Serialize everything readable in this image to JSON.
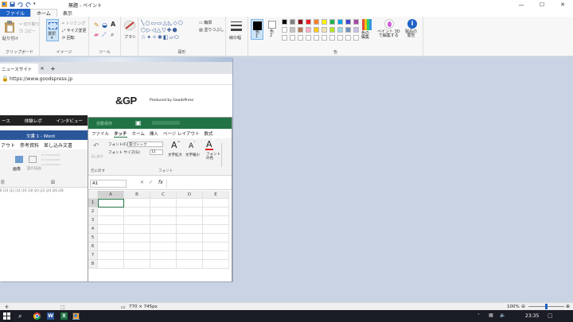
{
  "window": {
    "title": "無題 - ペイント",
    "quick_access": [
      "save-icon",
      "undo-icon",
      "redo-icon",
      "dropdown-icon"
    ],
    "controls": {
      "minimize": "—",
      "maximize": "☐",
      "close": "✕"
    }
  },
  "menu": {
    "file": "ファイル",
    "home": "ホーム",
    "view": "表示"
  },
  "ribbon": {
    "clipboard": {
      "label": "クリップボード",
      "paste": "貼り付け",
      "cut": "切り取り",
      "copy": "コピー"
    },
    "image": {
      "label": "イメージ",
      "select": "選択",
      "crop": "トリミング",
      "resize": "サイズ変更",
      "rotate": "回転"
    },
    "tools": {
      "label": "ツール"
    },
    "brush": {
      "label": "ブラシ"
    },
    "shapes": {
      "label": "図形",
      "outline": "輪郭",
      "fill": "塗りつぶし"
    },
    "size": {
      "label": "線の幅"
    },
    "colors": {
      "label": "色",
      "color1": "色\n1",
      "color2": "色\n2",
      "edit": "色の\n編集",
      "paint3d": "ペイント 3D\nで編集する",
      "alert": "製品の\n警告",
      "palette_row1": [
        "#000000",
        "#7f7f7f",
        "#880015",
        "#ed1c24",
        "#ff7f27",
        "#fff200",
        "#22b14c",
        "#00a2e8",
        "#3f48cc",
        "#a349a4"
      ],
      "palette_row2": [
        "#ffffff",
        "#c3c3c3",
        "#b97a57",
        "#ffaec9",
        "#ffc90e",
        "#efe4b0",
        "#b5e61d",
        "#99d9ea",
        "#7092be",
        "#c8bfe7"
      ],
      "accent": "#1e62c6"
    }
  },
  "canvas": {
    "browser": {
      "tab_title": "ニュースサイト",
      "new_tab": "+",
      "url": "https://www.goodspress.jp",
      "logo_text": "&GP",
      "logo_sub": "Produced by GoodsPress",
      "nav": [
        "ース",
        "体験レポ",
        "インタビュー"
      ]
    },
    "word": {
      "title": "文書 1 - Word",
      "tabs": [
        "アウト",
        "参考資料",
        "差し込み文書"
      ],
      "group_labels": [
        "原",
        "画像",
        "図の描画",
        "図"
      ],
      "ruler": "8 |10 |12 |14 |16 |18 |20 |22 |24 |26 |28"
    },
    "excel": {
      "titlebar_label": "自動保存",
      "tabs": [
        "ファイル",
        "タッチ",
        "ホーム",
        "挿入",
        "ページ レイアウト",
        "数式"
      ],
      "undo": "元に戻す",
      "font_label": "フォント(F):",
      "font_value": "游ゴシック",
      "font_size_label": "フォント サイズ(S):",
      "font_size_value": "11",
      "enlarge": "文字拡大",
      "shrink": "文字縮小",
      "font_color": "フォント\nの色",
      "font_group": "フォント",
      "undo_group": "元に戻す",
      "name_box": "A1",
      "fx": "fx",
      "columns": [
        "A",
        "B",
        "C",
        "D",
        "E"
      ],
      "rows": [
        "1",
        "2",
        "3",
        "4",
        "5",
        "6",
        "7",
        "8"
      ],
      "green": "#217346"
    }
  },
  "status": {
    "dimensions": "770 × 745px",
    "zoom": "100%",
    "zoom_level_fraction": 0.5
  },
  "taskbar": {
    "clock": "23:35",
    "apps": [
      "windows-icon",
      "search-icon",
      "taskview-icon",
      "chrome-icon",
      "word-icon",
      "excel-icon",
      "paint-icon"
    ]
  }
}
